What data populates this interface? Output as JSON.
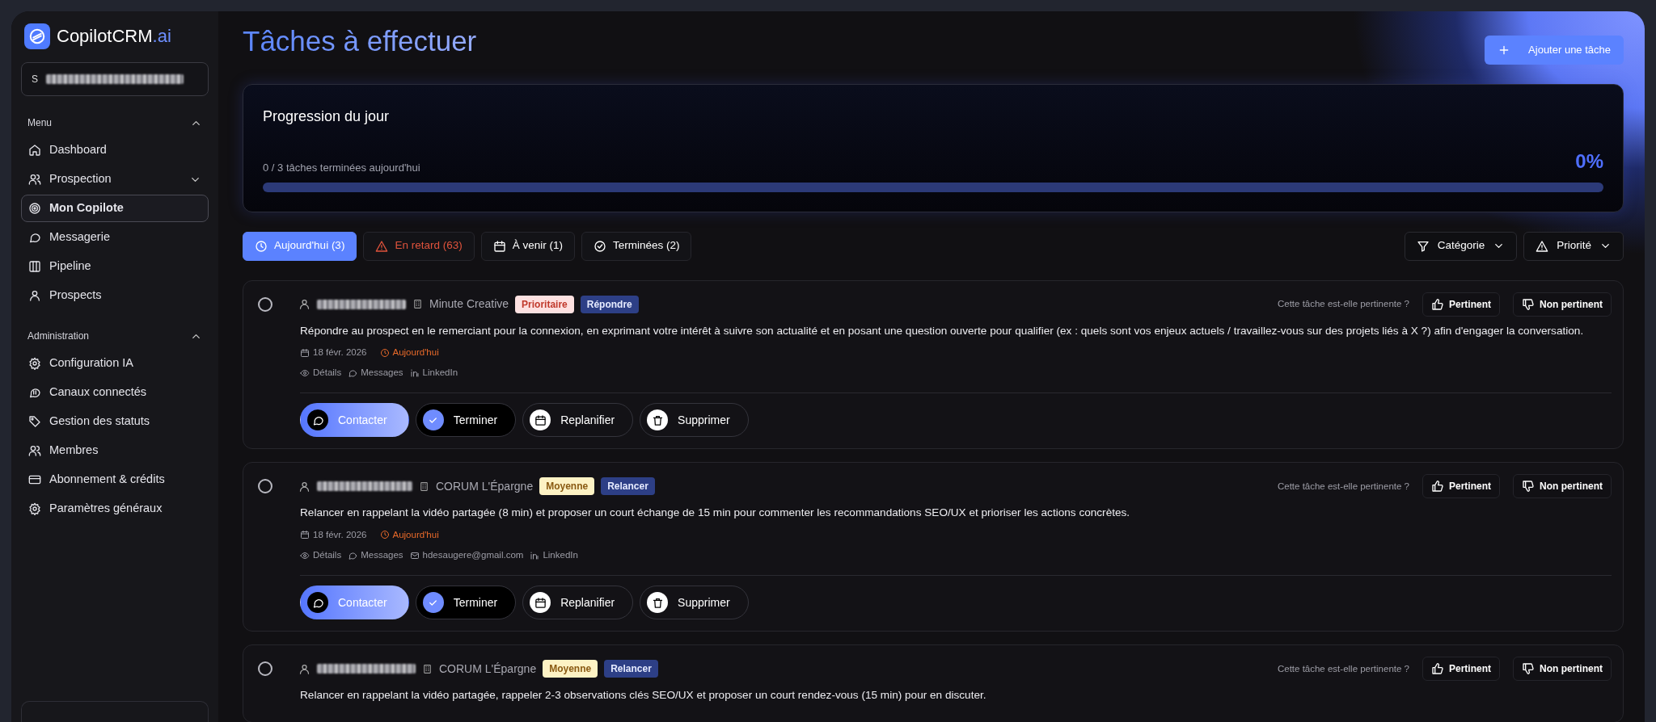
{
  "brand": {
    "name": "CopilotCRM",
    "suffix": ".ai"
  },
  "workspace": {
    "initial": "S"
  },
  "sidebar": {
    "sections": [
      {
        "title": "Menu",
        "expanded": true,
        "items": [
          {
            "label": "Dashboard",
            "selected": false
          },
          {
            "label": "Prospection",
            "selected": false,
            "expanded": false
          },
          {
            "label": "Mon Copilote",
            "selected": true
          },
          {
            "label": "Messagerie",
            "selected": false
          },
          {
            "label": "Pipeline",
            "selected": false
          },
          {
            "label": "Prospects",
            "selected": false
          }
        ]
      },
      {
        "title": "Administration",
        "expanded": true,
        "items": [
          {
            "label": "Configuration IA",
            "selected": false
          },
          {
            "label": "Canaux connectés",
            "selected": false
          },
          {
            "label": "Gestion des statuts",
            "selected": false
          },
          {
            "label": "Membres",
            "selected": false
          },
          {
            "label": "Abonnement & crédits",
            "selected": false
          },
          {
            "label": "Paramètres généraux",
            "selected": false
          }
        ]
      }
    ]
  },
  "page": {
    "title": "Tâches à effectuer",
    "add_button": "Ajouter une tâche"
  },
  "progress": {
    "title": "Progression du jour",
    "summary": "0 / 3 tâches terminées aujourd'hui",
    "percent": "0%",
    "level": 0
  },
  "tabs": [
    {
      "label": "Aujourd'hui (3)",
      "kind": "today",
      "selected": true
    },
    {
      "label": "En retard (63)",
      "kind": "late",
      "selected": false
    },
    {
      "label": "À venir (1)",
      "kind": "upcoming",
      "selected": false
    },
    {
      "label": "Terminées (2)",
      "kind": "done",
      "selected": false
    }
  ],
  "filters": [
    {
      "label": "Catégorie",
      "kind": "category"
    },
    {
      "label": "Priorité",
      "kind": "priority"
    }
  ],
  "tasks": [
    {
      "done": false,
      "company": "Minute Creative",
      "tags": [
        {
          "label": "Prioritaire",
          "kind": "high"
        },
        {
          "label": "Répondre",
          "kind": "action"
        }
      ],
      "question": "Cette tâche est-elle pertinente ?",
      "feedback": [
        "Pertinent",
        "Non pertinent"
      ],
      "description": "Répondre au prospect en le remerciant pour la connexion, en exprimant votre intérêt à suivre son actualité et en posant une question ouverte pour qualifier (ex : quels sont vos enjeux actuels / travaillez-vous sur des projets liés à X ?) afin d'engager la conversation.",
      "date": "18 févr. 2026",
      "due": "Aujourd'hui",
      "links": [
        {
          "kind": "details",
          "label": "Détails"
        },
        {
          "kind": "messages",
          "label": "Messages"
        },
        {
          "kind": "linkedin",
          "label": "LinkedIn"
        }
      ],
      "actions": [
        {
          "kind": "contact",
          "label": "Contacter"
        },
        {
          "kind": "complete",
          "label": "Terminer"
        },
        {
          "kind": "reschedule",
          "label": "Replanifier"
        },
        {
          "kind": "delete",
          "label": "Supprimer"
        }
      ]
    },
    {
      "done": false,
      "company": "CORUM L'Épargne",
      "tags": [
        {
          "label": "Moyenne",
          "kind": "medium"
        },
        {
          "label": "Relancer",
          "kind": "action"
        }
      ],
      "question": "Cette tâche est-elle pertinente ?",
      "feedback": [
        "Pertinent",
        "Non pertinent"
      ],
      "description": "Relancer en rappelant la vidéo partagée (8 min) et proposer un court échange de 15 min pour commenter les recommandations SEO/UX et prioriser les actions concrètes.",
      "date": "18 févr. 2026",
      "due": "Aujourd'hui",
      "links": [
        {
          "kind": "details",
          "label": "Détails"
        },
        {
          "kind": "messages",
          "label": "Messages"
        },
        {
          "kind": "email",
          "label": "hdesaugere@gmail.com"
        },
        {
          "kind": "linkedin",
          "label": "LinkedIn"
        }
      ],
      "actions": [
        {
          "kind": "contact",
          "label": "Contacter"
        },
        {
          "kind": "complete",
          "label": "Terminer"
        },
        {
          "kind": "reschedule",
          "label": "Replanifier"
        },
        {
          "kind": "delete",
          "label": "Supprimer"
        }
      ]
    },
    {
      "done": false,
      "company": "CORUM L'Épargne",
      "tags": [
        {
          "label": "Moyenne",
          "kind": "medium"
        },
        {
          "label": "Relancer",
          "kind": "action"
        }
      ],
      "question": "Cette tâche est-elle pertinente ?",
      "feedback": [
        "Pertinent",
        "Non pertinent"
      ],
      "description": "Relancer en rappelant la vidéo partagée, rappeler 2-3 observations clés SEO/UX et proposer un court rendez-vous (15 min) pour en discuter."
    }
  ]
}
